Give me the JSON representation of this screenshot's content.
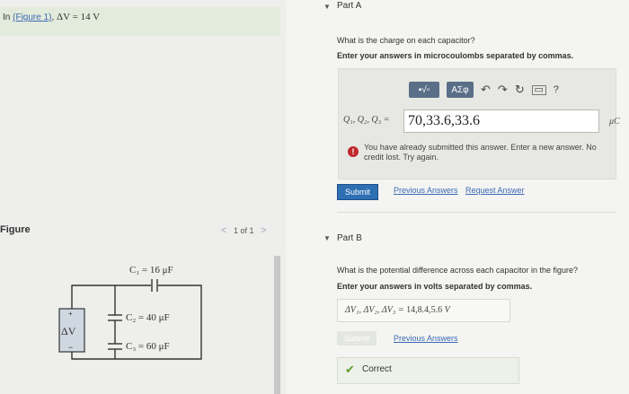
{
  "intro": {
    "prefix": "In",
    "figure_link": "(Figure 1)",
    "math": "ΔV = 14 V"
  },
  "figure": {
    "label": "Figure",
    "pager": "1 of 1",
    "prev_arrow": "<",
    "next_arrow": ">",
    "circuit": {
      "c1": "C₁ = 16 μF",
      "c2": "C₂ = 40 μF",
      "c3": "C₃ = 60 μF",
      "source": "ΔV",
      "plus": "+",
      "minus": "−"
    }
  },
  "part_a": {
    "title": "Part A",
    "question": "What is the charge on each capacitor?",
    "instruction": "Enter your answers in microcoulombs separated by commas.",
    "toolbar": {
      "templates_label": "▪√▫",
      "symbols_label": "ΑΣφ",
      "help_label": "?"
    },
    "input_label": "Q₁, Q₂, Q₃ =",
    "input_value": "70,33.6,33.6",
    "unit": "μC",
    "warning": "You have already submitted this answer. Enter a new answer. No credit lost. Try again.",
    "submit_label": "Submit",
    "previous_answers": "Previous Answers",
    "request_answer": "Request Answer"
  },
  "part_b": {
    "title": "Part B",
    "question": "What is the potential difference across each capacitor in the figure?",
    "instruction": "Enter your answers in volts separated by commas.",
    "answer_label": "ΔV₁, ΔV₂, ΔV₃ =",
    "answer_value": "14,8.4,5.6",
    "answer_unit": "V",
    "submit_label": "Submit",
    "previous_answers": "Previous Answers",
    "status": "Correct"
  },
  "colors": {
    "link": "#3b69b3",
    "submit": "#2e6fb3",
    "warning": "#c1272d",
    "correct": "#5a9e2f"
  }
}
